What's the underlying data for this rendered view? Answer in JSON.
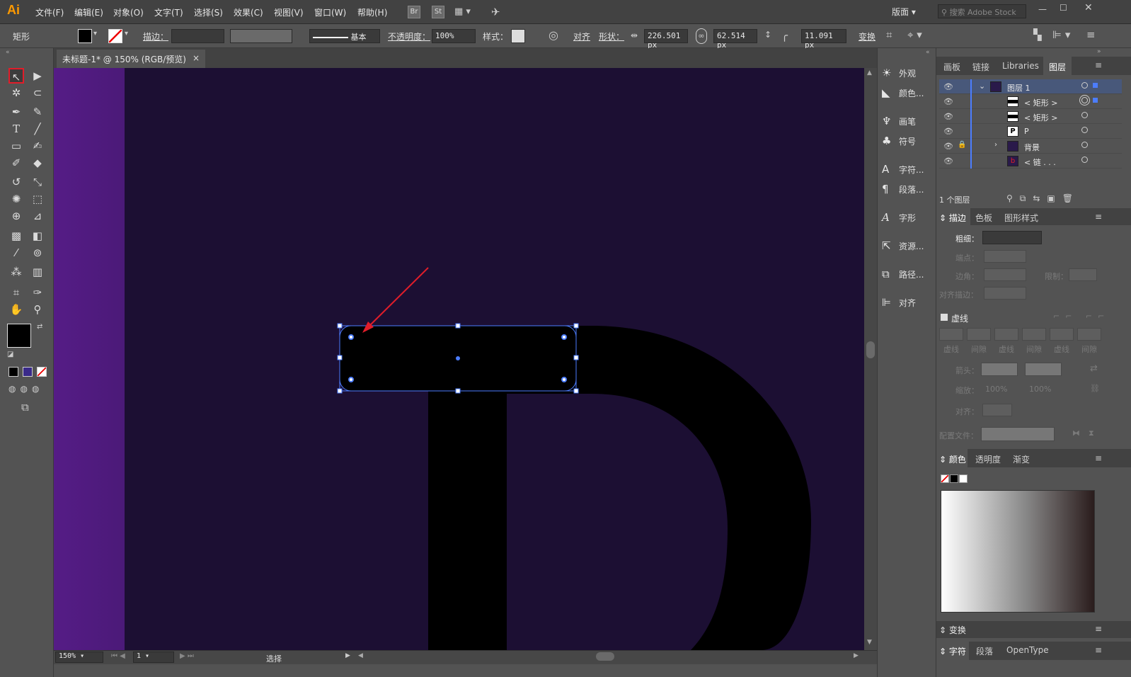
{
  "app": {
    "logo": "Ai"
  },
  "menu": [
    "文件(F)",
    "编辑(E)",
    "对象(O)",
    "文字(T)",
    "选择(S)",
    "效果(C)",
    "视图(V)",
    "窗口(W)",
    "帮助(H)"
  ],
  "menu_badges": [
    "Br",
    "St"
  ],
  "workspace": "版面",
  "search_placeholder": "搜索 Adobe Stock",
  "control": {
    "object_type": "矩形",
    "stroke_label": "描边：",
    "stroke_style": "基本",
    "opacity_label": "不透明度：",
    "opacity_value": "100%",
    "style_label": "样式：",
    "align_label": "对齐",
    "shape_label": "形状：",
    "width": "226.501 px",
    "height": "62.514 px",
    "corner": "11.091 px",
    "transform_label": "变换"
  },
  "document": {
    "tab_title": "未标题-1* @ 150% (RGB/预览)",
    "close": "×"
  },
  "status": {
    "zoom": "150%",
    "artboard": "1",
    "tool_name": "选择"
  },
  "mid_panel": [
    "外观",
    "颜色...",
    "画笔",
    "符号",
    "字符...",
    "段落...",
    "字形",
    "资源...",
    "路径...",
    "对齐"
  ],
  "layers_panel": {
    "tabs": [
      "画板",
      "链接",
      "Libraries",
      "图层"
    ],
    "active_tab": "图层",
    "rows": [
      {
        "name": "图层 1",
        "type": "layer"
      },
      {
        "name": "< 矩形 >",
        "type": "rect"
      },
      {
        "name": "< 矩形 >",
        "type": "rect"
      },
      {
        "name": "P",
        "type": "text"
      },
      {
        "name": "背景",
        "type": "group"
      },
      {
        "name": "< 链 . . .",
        "type": "link"
      }
    ],
    "count": "1 个图层"
  },
  "stroke_panel": {
    "tabs": [
      "描边",
      "色板",
      "图形样式"
    ],
    "weight_label": "粗细：",
    "cap_label": "端点：",
    "corner_label": "边角：",
    "limit_label": "限制：",
    "align_label": "对齐描边：",
    "dashed_label": "虚线",
    "dash_labels": [
      "虚线",
      "间隙",
      "虚线",
      "间隙",
      "虚线",
      "间隙"
    ],
    "arrow_label": "箭头：",
    "scale_label": "缩放：",
    "scale_values": [
      "100%",
      "100%"
    ],
    "align2_label": "对齐：",
    "profile_label": "配置文件："
  },
  "color_panel": {
    "tabs": [
      "颜色",
      "透明度",
      "渐变"
    ]
  },
  "bottom_tabs": {
    "transform": "变换",
    "char_tabs": [
      "字符",
      "段落",
      "OpenType"
    ]
  },
  "colors": {
    "canvas": "#1c0f33",
    "artboard_strip": "#551c86",
    "selection": "#4c7dff",
    "arrow": "#e11d2a"
  }
}
